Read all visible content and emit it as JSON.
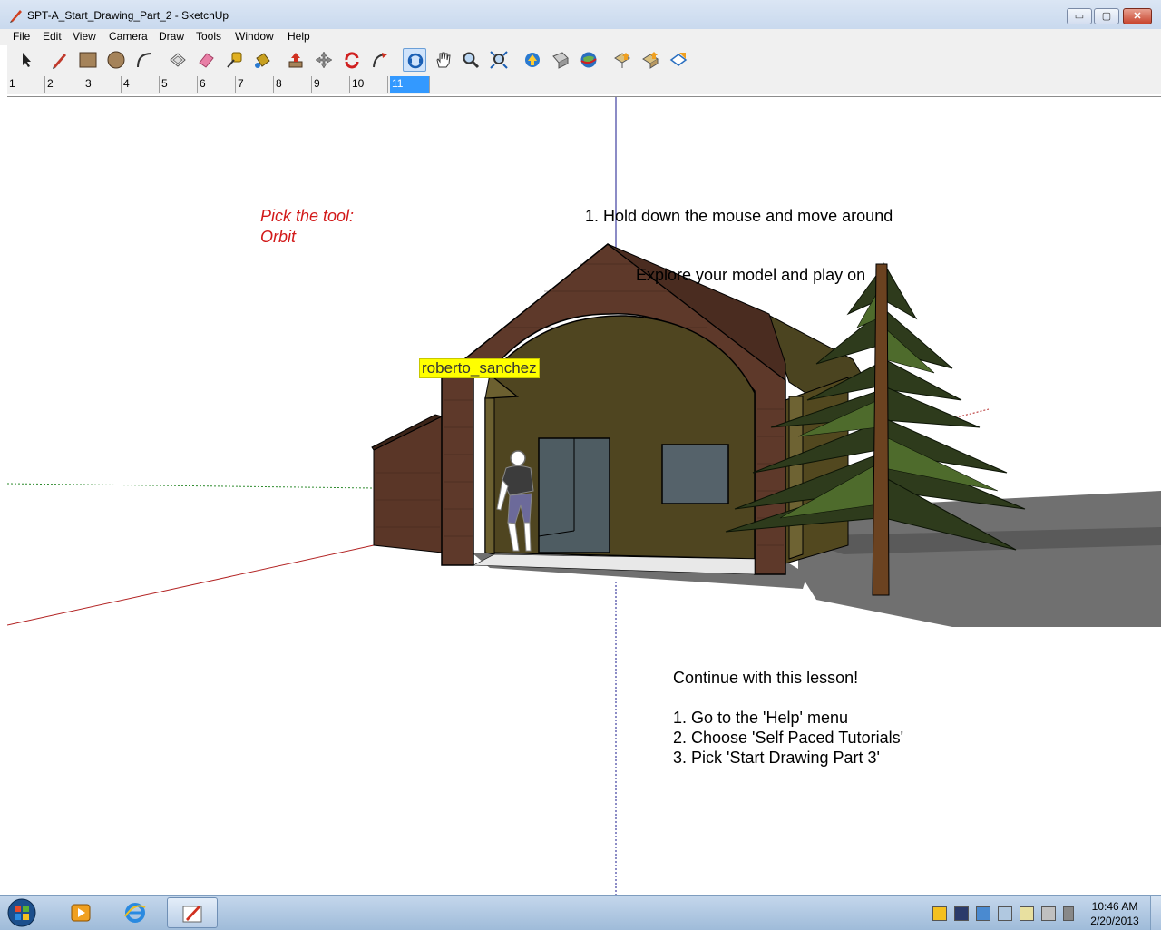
{
  "window": {
    "title": "SPT-A_Start_Drawing_Part_2 - SketchUp",
    "min_glyph": "▭",
    "max_glyph": "▢",
    "close_glyph": "✕"
  },
  "menu": [
    "File",
    "Edit",
    "View",
    "Camera",
    "Draw",
    "Tools",
    "Window",
    "Help"
  ],
  "toolbar": {
    "tools": [
      "select-icon",
      "pencil-icon",
      "rectangle-icon",
      "circle-icon",
      "arc-icon",
      "make-component-icon",
      "eraser-icon",
      "tape-measure-icon",
      "paint-bucket-icon",
      "push-pull-icon",
      "move-icon",
      "rotate-icon",
      "follow-me-icon",
      "orbit-icon",
      "pan-icon",
      "zoom-icon",
      "zoom-extents-icon",
      "get-models-icon",
      "share-model-icon",
      "google-earth-icon",
      "get-photo-texture-icon",
      "share-component-icon",
      "preview-in-earth-icon"
    ],
    "active": "orbit-icon"
  },
  "scenes": {
    "tabs": [
      "1",
      "2",
      "3",
      "4",
      "5",
      "6",
      "7",
      "8",
      "9",
      "10",
      "11"
    ],
    "active": "11"
  },
  "viewport": {
    "tool_hint_line1": "Pick the tool:",
    "tool_hint_line2": "Orbit",
    "instruction_1": "1. Hold down the mouse and move around",
    "instruction_2": "Explore your model and play on",
    "author_label": "roberto_sanchez",
    "continue_title": "Continue with this lesson!",
    "steps": [
      "1. Go to the 'Help' menu",
      "2. Choose 'Self Paced Tutorials'",
      "3. Pick 'Start Drawing Part 3'"
    ]
  },
  "taskbar": {
    "apps": [
      "media-player-icon",
      "internet-explorer-icon",
      "sketchup-icon"
    ],
    "active_app": "sketchup-icon",
    "time": "10:46 AM",
    "date": "2/20/2013"
  },
  "colors": {
    "axis_red": "#b22222",
    "axis_green": "#2e8b2e",
    "axis_blue": "#1a1a8c",
    "highlight": "#3399ff",
    "hint_red": "#d21a1a",
    "label_yellow": "#ffff00"
  }
}
